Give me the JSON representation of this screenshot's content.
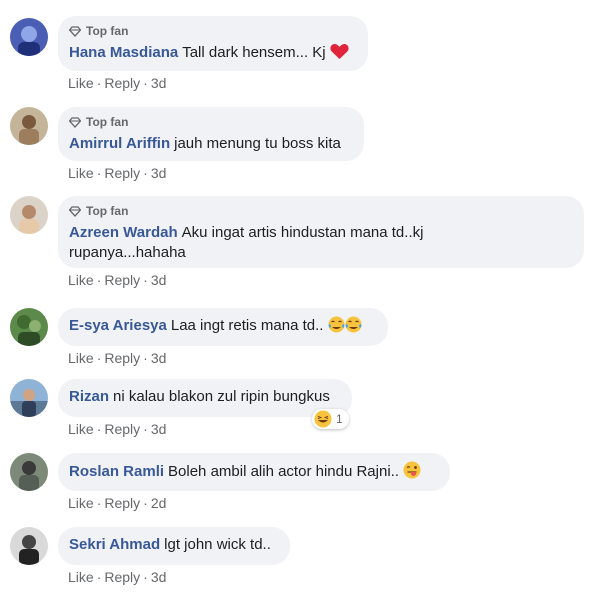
{
  "colors": {
    "author": "#385898",
    "bubble": "#f0f2f5",
    "meta": "#65676b",
    "heart": "#e0243c",
    "laugh": "#f7c33c"
  },
  "comments": [
    {
      "top_fan": "Top fan",
      "author": "Hana Masdiana",
      "text": "Tall dark hensem... Kj",
      "emojis": [
        "red-heart-icon"
      ],
      "like": "Like",
      "reply": "Reply",
      "time": "3d"
    },
    {
      "top_fan": "Top fan",
      "author": "Amirrul Ariffin",
      "text": "jauh menung tu boss kita",
      "like": "Like",
      "reply": "Reply",
      "time": "3d"
    },
    {
      "top_fan": "Top fan",
      "author": "Azreen Wardah",
      "text": "Aku ingat artis hindustan mana td..kj",
      "text2": "rupanya...hahaha",
      "like": "Like",
      "reply": "Reply",
      "time": "3d"
    },
    {
      "author": "E-sya Ariesya",
      "text": "Laa ingt retis mana td..",
      "emojis": [
        "tears-of-joy-icon",
        "tears-of-joy-icon"
      ],
      "like": "Like",
      "reply": "Reply",
      "time": "3d"
    },
    {
      "author": "Rizan",
      "text": "ni kalau blakon zul ripin bungkus",
      "reaction": {
        "icon": "laughing-reaction-icon",
        "count": "1"
      },
      "like": "Like",
      "reply": "Reply",
      "time": "3d"
    },
    {
      "author": "Roslan Ramli",
      "text": "Boleh ambil alih actor hindu Rajni..",
      "emojis": [
        "winking-tongue-icon"
      ],
      "like": "Like",
      "reply": "Reply",
      "time": "2d"
    },
    {
      "author": "Sekri Ahmad",
      "text": "lgt john wick td..",
      "like": "Like",
      "reply": "Reply",
      "time": "3d"
    }
  ]
}
